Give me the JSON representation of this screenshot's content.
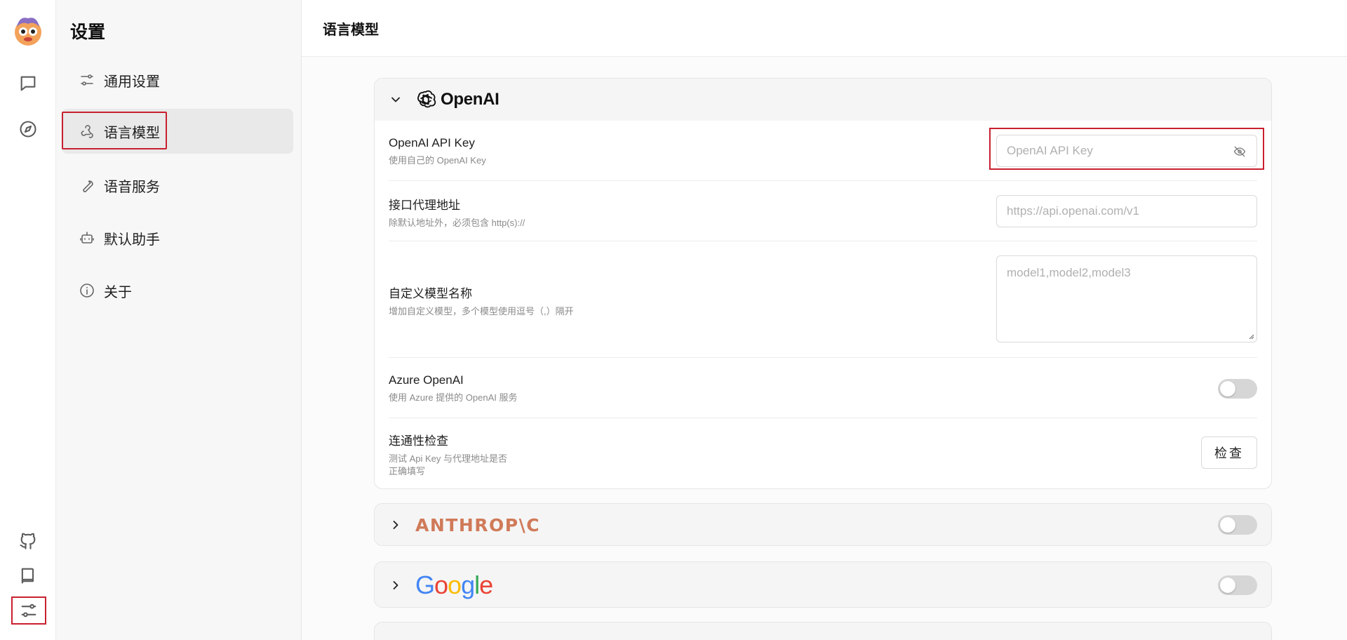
{
  "rail": {
    "items": [
      {
        "name": "chat",
        "icon": "chat-bubble-icon"
      },
      {
        "name": "discover",
        "icon": "compass-icon"
      },
      {
        "name": "github",
        "icon": "github-icon"
      },
      {
        "name": "docs",
        "icon": "book-icon"
      },
      {
        "name": "settings",
        "icon": "sliders-icon"
      }
    ]
  },
  "sidebar": {
    "title": "设置",
    "items": [
      {
        "label": "通用设置",
        "icon": "sliders-icon"
      },
      {
        "label": "语言模型",
        "icon": "webhook-icon"
      },
      {
        "label": "语音服务",
        "icon": "wrench-icon"
      },
      {
        "label": "默认助手",
        "icon": "robot-icon"
      },
      {
        "label": "关于",
        "icon": "info-icon"
      }
    ]
  },
  "main": {
    "header_title": "语言模型",
    "openai": {
      "brand": "OpenAI",
      "rows": {
        "api_key": {
          "title": "OpenAI API Key",
          "desc": "使用自己的 OpenAI Key",
          "placeholder": "OpenAI API Key"
        },
        "proxy": {
          "title": "接口代理地址",
          "desc": "除默认地址外，必须包含 http(s)://",
          "placeholder": "https://api.openai.com/v1"
        },
        "custom_models": {
          "title": "自定义模型名称",
          "desc": "增加自定义模型，多个模型使用逗号（,）隔开",
          "placeholder": "model1,model2,model3"
        },
        "azure": {
          "title": "Azure OpenAI",
          "desc": "使用 Azure 提供的 OpenAI 服务"
        },
        "check": {
          "title": "连通性检查",
          "desc_line1": "测试 Api Key 与代理地址是否",
          "desc_line2": "正确填写",
          "button": "检查"
        }
      }
    },
    "anthropic": {
      "brand": "ANTHROP\\C"
    },
    "google": {
      "brand": "Google"
    }
  },
  "colors": {
    "highlight": "#c8202f",
    "anthropic": "#d07a59",
    "google_blue": "#4285f4",
    "google_red": "#ea4335",
    "google_yellow": "#fbbc05",
    "google_green": "#34a853"
  }
}
